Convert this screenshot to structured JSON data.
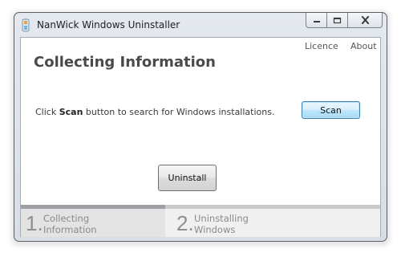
{
  "window": {
    "title": "NanWick Windows Uninstaller",
    "icon": "uninstaller-app-icon"
  },
  "caption_buttons": {
    "minimize_icon": "minimize-icon",
    "maximize_icon": "maximize-icon",
    "close_icon": "close-icon"
  },
  "header_links": {
    "licence": "Licence",
    "about": "About"
  },
  "page": {
    "heading": "Collecting Information",
    "instruction_prefix": "Click",
    "instruction_bold": "Scan",
    "instruction_suffix": "button to search for Windows installations.",
    "scan_label": "Scan",
    "uninstall_label": "Uninstall"
  },
  "steps": [
    {
      "number": "1.",
      "line1": "Collecting",
      "line2": "Information",
      "active": true
    },
    {
      "number": "2.",
      "line1": "Uninstalling",
      "line2": "Windows",
      "active": false
    }
  ],
  "colors": {
    "scan_button_border": "#3c7fb1",
    "active_step_bar": "#9d9fa3"
  }
}
